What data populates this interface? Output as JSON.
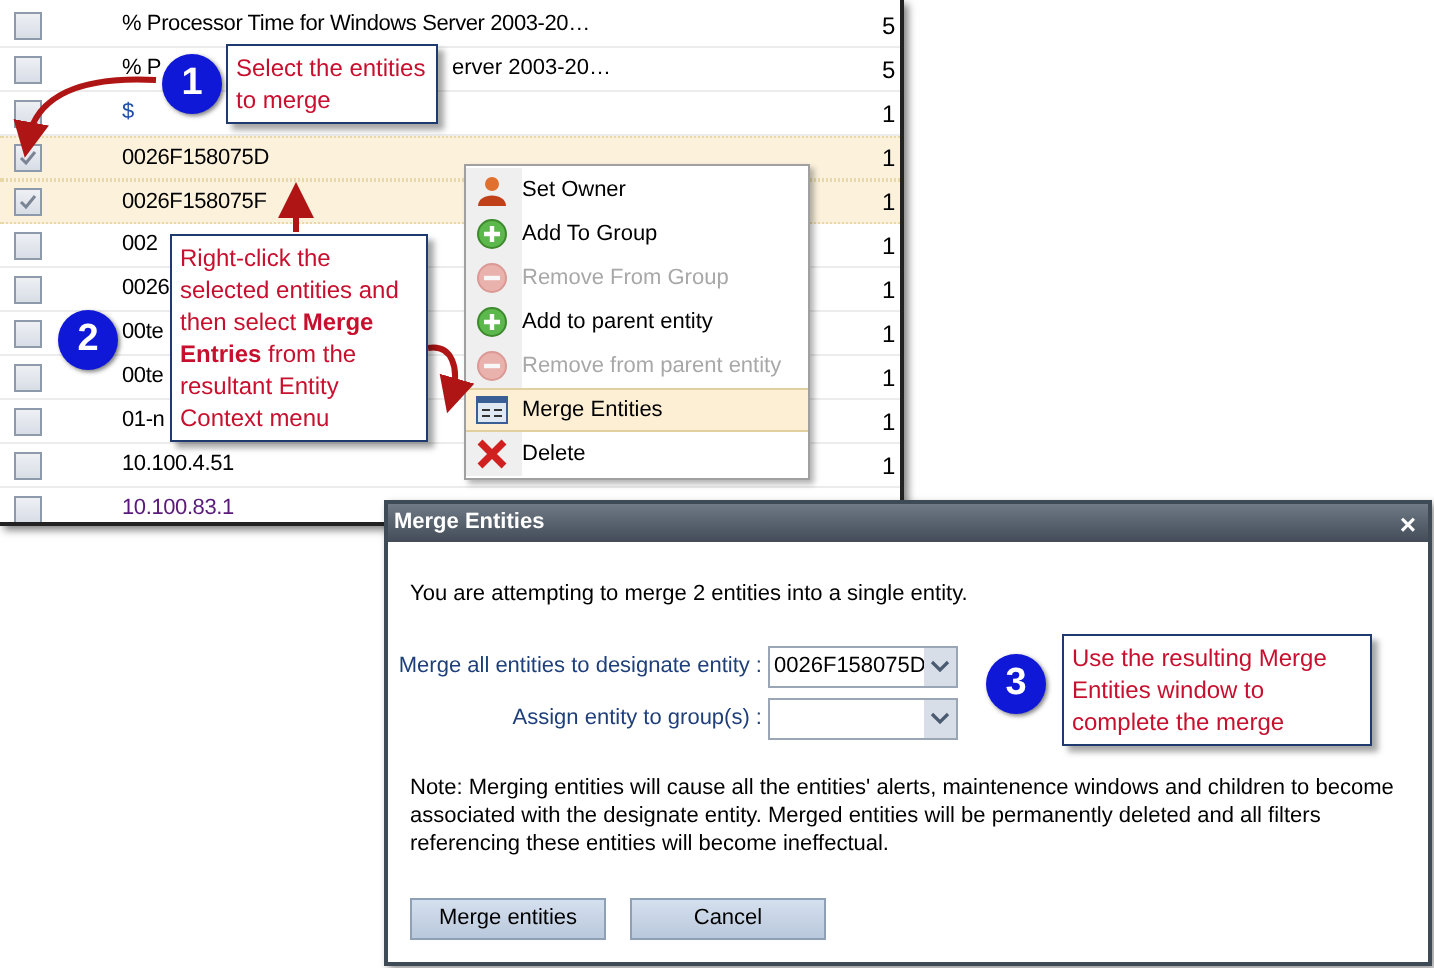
{
  "entity_list": {
    "rows": [
      {
        "name": "% Processor Time for Windows Server 2003-20…",
        "value": "5",
        "checked": false,
        "color": "#000000"
      },
      {
        "name": "% P",
        "name_tail": "erver 2003-20…",
        "value": "5",
        "checked": false,
        "color": "#000000"
      },
      {
        "name": "$",
        "value": "1",
        "checked": false,
        "color": "#1f4fa8"
      },
      {
        "name": "0026F158075D",
        "value": "1",
        "checked": true,
        "color": "#000000"
      },
      {
        "name": "0026F158075F",
        "value": "1",
        "checked": true,
        "color": "#000000"
      },
      {
        "name": "002",
        "value": "1",
        "checked": false,
        "color": "#000000"
      },
      {
        "name": "0026",
        "value": "1",
        "checked": false,
        "color": "#000000"
      },
      {
        "name": "00te",
        "value": "1",
        "checked": false,
        "color": "#000000"
      },
      {
        "name": "00te",
        "value": "1",
        "checked": false,
        "color": "#000000"
      },
      {
        "name": "01-n",
        "value": "1",
        "checked": false,
        "color": "#000000"
      },
      {
        "name": "10.100.4.51",
        "value": "1",
        "checked": false,
        "color": "#000000"
      },
      {
        "name": "10.100.83.1",
        "checked": false,
        "color": "#5a1a7a"
      }
    ]
  },
  "context_menu": {
    "items": [
      {
        "label": "Set Owner",
        "kind": "owner",
        "disabled": false,
        "highlighted": false
      },
      {
        "label": "Add To Group",
        "kind": "add",
        "disabled": false,
        "highlighted": false
      },
      {
        "label": "Remove From Group",
        "kind": "remove",
        "disabled": true,
        "highlighted": false
      },
      {
        "label": "Add to parent entity",
        "kind": "add",
        "disabled": false,
        "highlighted": false
      },
      {
        "label": "Remove from parent entity",
        "kind": "remove",
        "disabled": true,
        "highlighted": false
      },
      {
        "label": "Merge Entities",
        "kind": "merge",
        "disabled": false,
        "highlighted": true
      },
      {
        "label": "Delete",
        "kind": "delete",
        "disabled": false,
        "highlighted": false
      }
    ]
  },
  "dialog": {
    "title": "Merge Entities",
    "close": "×",
    "intro": "You are attempting to merge 2 entities into a single entity.",
    "fields": [
      {
        "label": "Merge all entities to designate entity :",
        "value": "0026F158075D"
      },
      {
        "label": "Assign entity to group(s) :"
      }
    ],
    "note": "Note: Merging entities will cause all the entities' alerts, maintenence windows and children to become associated with the designate entity. Merged entities will be permanently deleted and all filters referencing these entities will become ineffectual.",
    "buttons": [
      "Merge entities",
      "Cancel"
    ]
  },
  "callouts": [
    {
      "number": "1",
      "text": "Select the entities to merge"
    },
    {
      "number": "2",
      "text": "Right-click the selected entities and then select **Merge Entries** from the resultant Entity Context menu"
    },
    {
      "number": "3",
      "text": "Use the resulting Merge Entities window to complete the merge"
    }
  ]
}
